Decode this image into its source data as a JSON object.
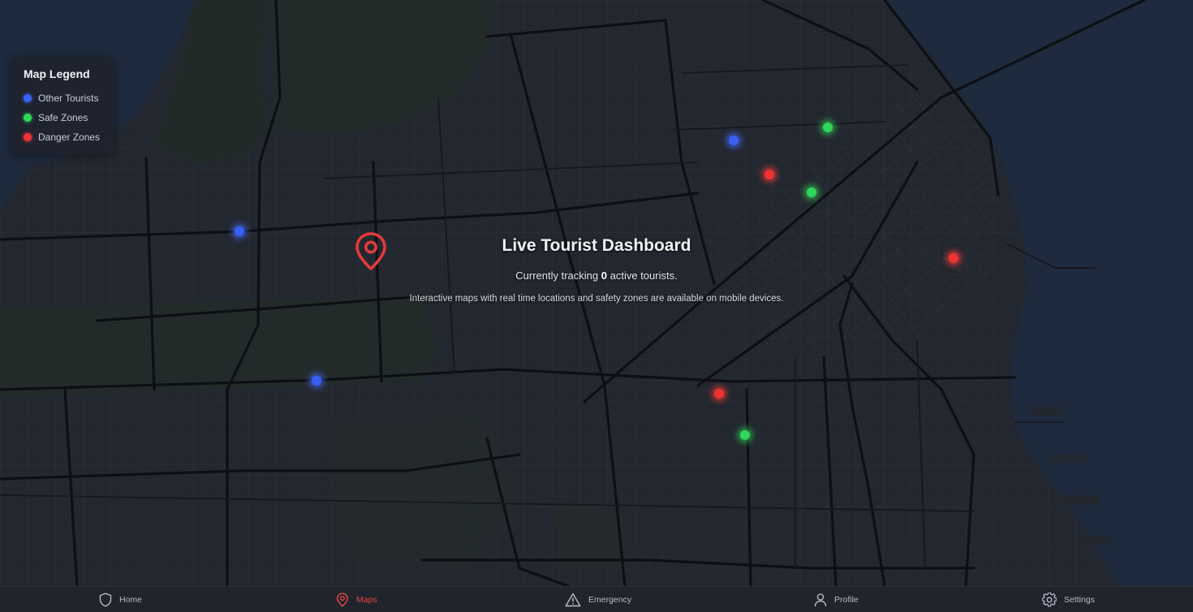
{
  "legend": {
    "title": "Map Legend",
    "items": [
      {
        "label": "Other Tourists",
        "color": "#3a5ff5"
      },
      {
        "label": "Safe Zones",
        "color": "#2fd65a"
      },
      {
        "label": "Danger Zones",
        "color": "#ee3333"
      }
    ]
  },
  "dashboard": {
    "pin_icon": "map-pin-icon",
    "title": "Live Tourist Dashboard",
    "tracking_prefix": "Currently tracking",
    "tracking_count": "0",
    "tracking_suffix": "active tourists.",
    "mobile_note": "Interactive maps with real time locations and safety zones are available on mobile devices."
  },
  "markers": {
    "tourists_color": "#3a5ff5",
    "safe_color": "#2fd65a",
    "danger_color": "#ee3333"
  },
  "nav": {
    "active_color": "#e64545",
    "items": [
      {
        "label": "Home",
        "icon": "shield-icon"
      },
      {
        "label": "Maps",
        "icon": "map-pin-icon",
        "active": true
      },
      {
        "label": "Emergency",
        "icon": "warning-triangle-icon"
      },
      {
        "label": "Profile",
        "icon": "user-icon"
      },
      {
        "label": "Settings",
        "icon": "gear-icon"
      }
    ]
  }
}
